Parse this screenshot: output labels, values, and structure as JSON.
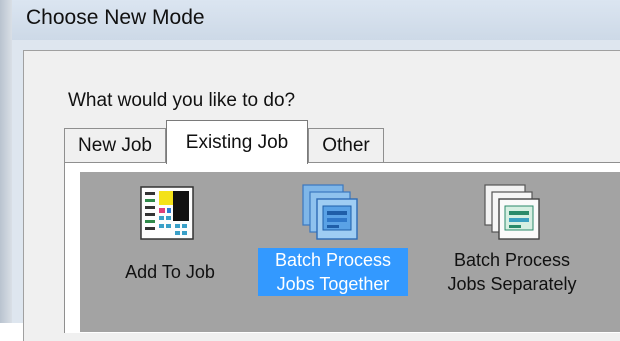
{
  "window": {
    "title": "Choose New Mode"
  },
  "dialog": {
    "question": "What would you like to do?",
    "tabs": [
      {
        "label": "New Job",
        "selected": false
      },
      {
        "label": "Existing Job",
        "selected": true
      },
      {
        "label": "Other",
        "selected": false
      }
    ],
    "items": [
      {
        "label": "Add To Job",
        "icon": "add-to-job-icon",
        "selected": false
      },
      {
        "label": "Batch Process\nJobs Together",
        "icon": "batch-together-icon",
        "selected": true
      },
      {
        "label": "Batch Process\nJobs Separately",
        "icon": "batch-separately-icon",
        "selected": false
      }
    ]
  },
  "colors": {
    "listview_background": "#a3a3a3",
    "selection": "#3399ff",
    "titlebar": "#d6e0ec"
  }
}
